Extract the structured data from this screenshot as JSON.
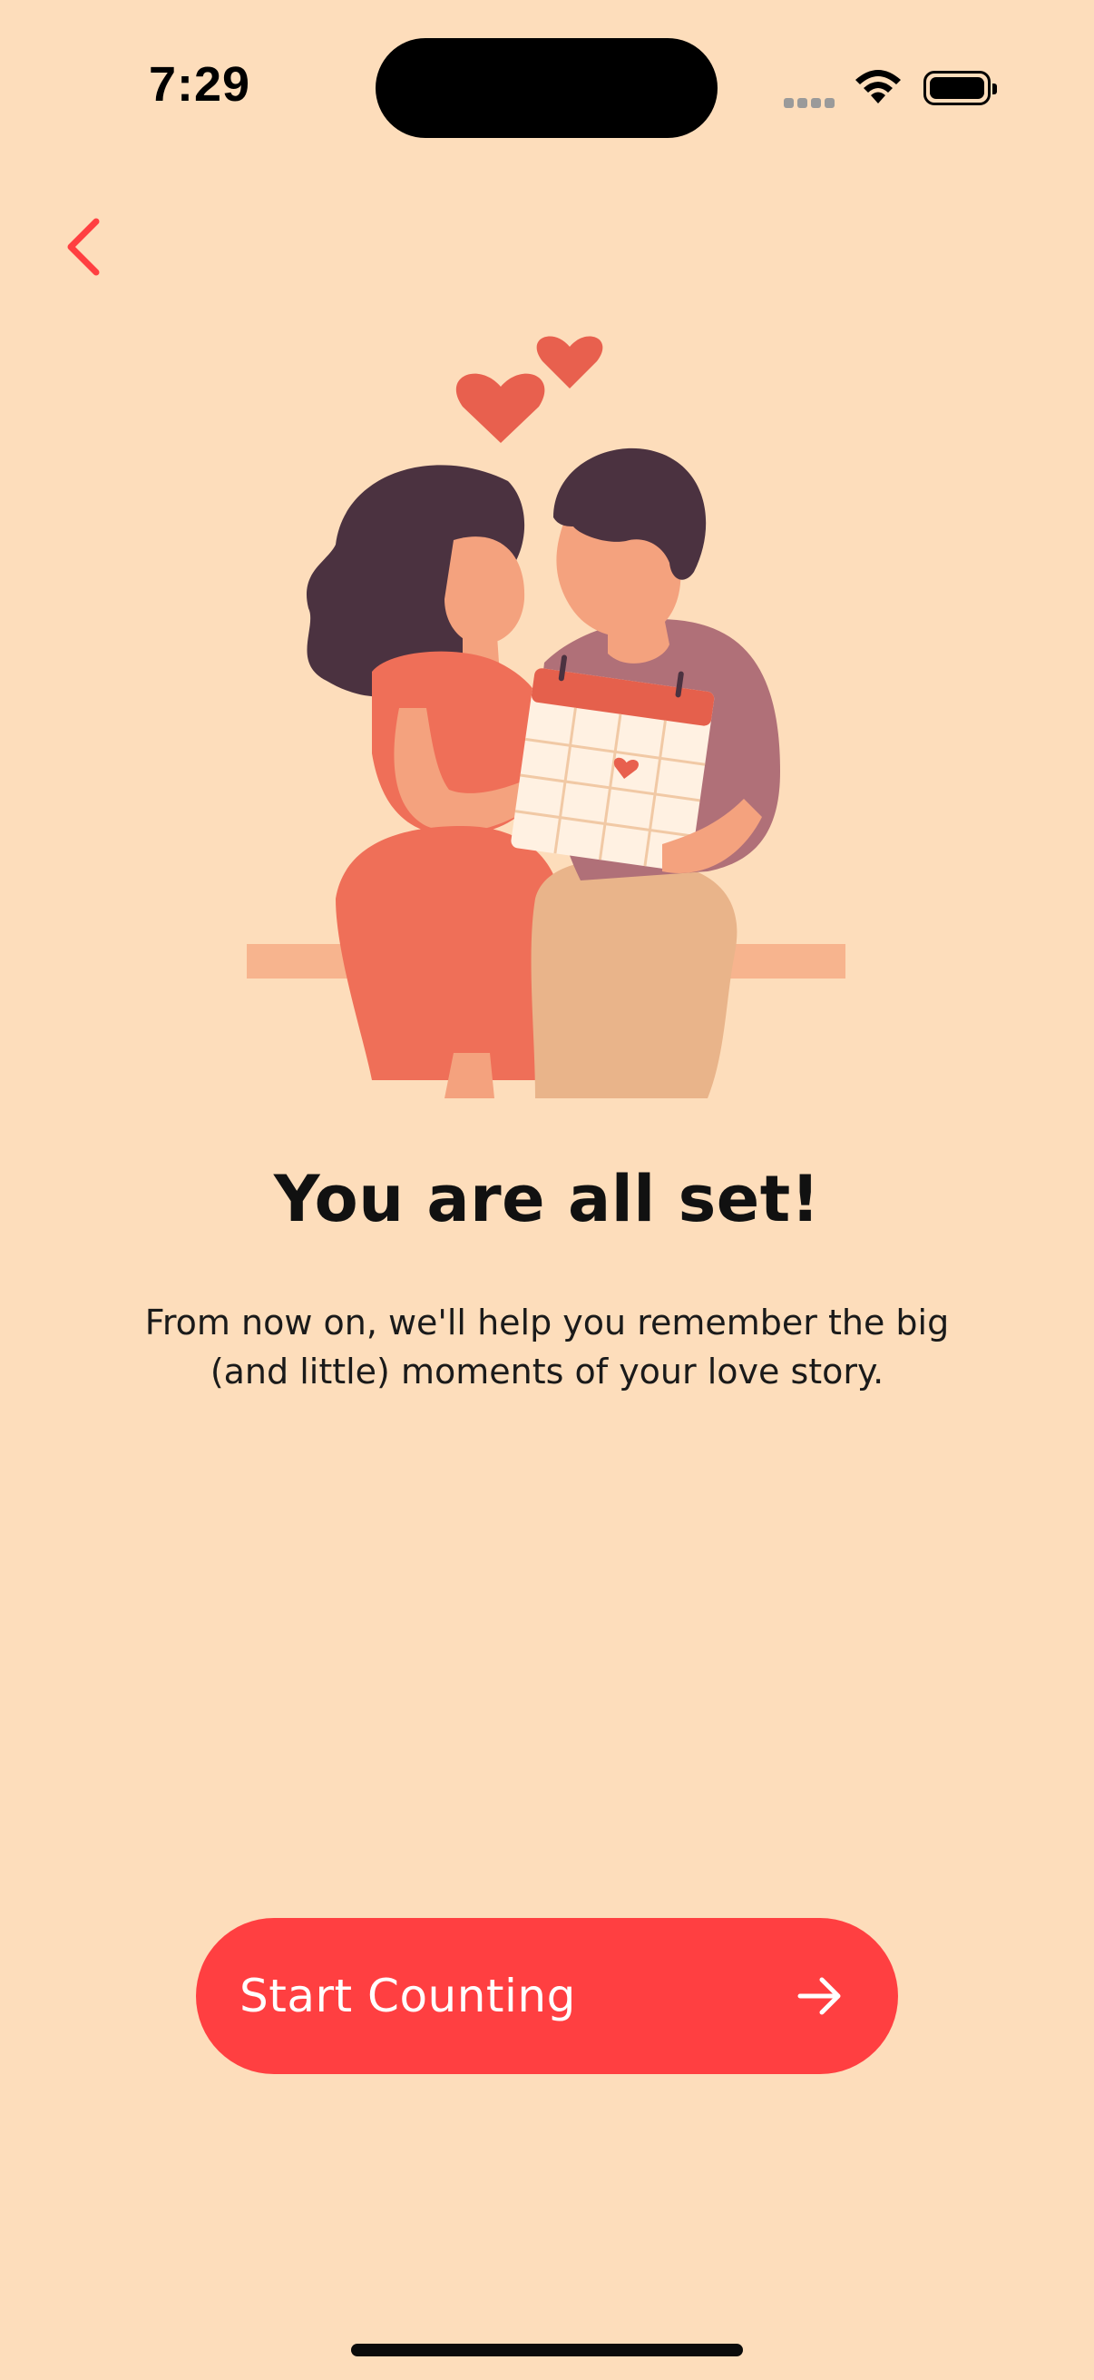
{
  "status_bar": {
    "time": "7:29"
  },
  "navigation": {
    "back_icon": "chevron-left-icon"
  },
  "illustration": {
    "icon": "couple-with-calendar-illustration"
  },
  "content": {
    "title": "You are all set!",
    "subtitle": "From now on, we'll help you remember the big (and little) moments of your love story."
  },
  "cta": {
    "label": "Start Counting",
    "icon": "arrow-right-icon"
  },
  "colors": {
    "background": "#FDDDBB",
    "accent": "#FF3F41",
    "text": "#111111"
  }
}
